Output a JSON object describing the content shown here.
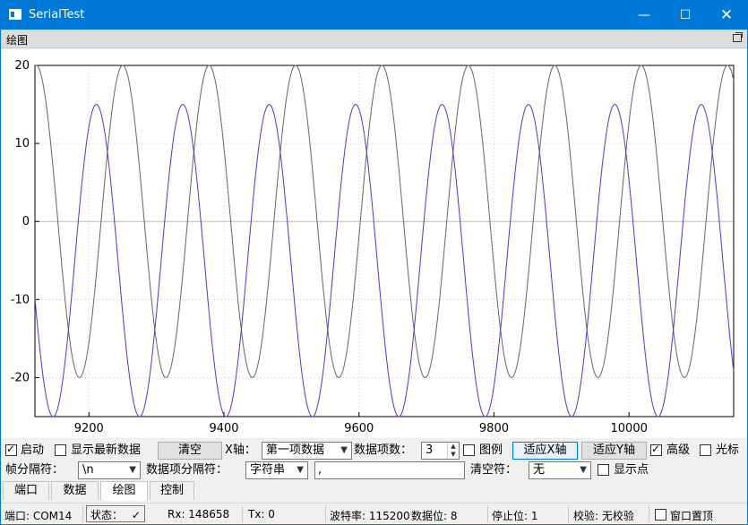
{
  "window": {
    "title": "SerialTest"
  },
  "dock": {
    "title": "绘图"
  },
  "chart_data": {
    "type": "line",
    "title": "",
    "xlabel": "",
    "ylabel": "",
    "xlim": [
      9120,
      9156
    ],
    "ylim": [
      -25,
      20
    ],
    "x_ticks": [
      "9200",
      "9400",
      "9600",
      "9800",
      "10000"
    ],
    "y_ticks": [
      "20",
      "10",
      "0",
      "-10",
      "-20"
    ],
    "grid": true,
    "legend": "none",
    "series": [
      {
        "color": "#666666",
        "amplitude": 20,
        "period": 128,
        "phase_x_peak": 9122,
        "points_sample": [
          [
            9122,
            20
          ],
          [
            9186,
            -20
          ],
          [
            9250,
            20
          ],
          [
            9314,
            -20
          ],
          [
            9378,
            20
          ]
        ]
      },
      {
        "color": "#4040c8",
        "amplitude": 20,
        "offset": -5,
        "period": 128,
        "phase_x_peak": 9211,
        "points_sample": [
          [
            9147,
            -25
          ],
          [
            9211,
            15
          ],
          [
            9275,
            -25
          ],
          [
            9339,
            15
          ],
          [
            9403,
            -25
          ]
        ]
      }
    ]
  },
  "controls": {
    "start_label": "启动",
    "show_latest_label": "显示最新数据",
    "clear_label": "清空",
    "x_axis_label": "X轴：",
    "x_axis_value": "第一项数据",
    "item_count_label": "数据项数：",
    "item_count_value": "3",
    "legend_label": "图例",
    "fit_x_label": "适应X轴",
    "fit_y_label": "适应Y轴",
    "advanced_label": "高级",
    "cursor_label": "光标",
    "frame_sep_label": "帧分隔符：",
    "frame_sep_value": "\\n",
    "item_sep_label": "数据项分隔符：",
    "item_sep_type": "字符串",
    "item_sep_value": ",",
    "blank_label": "清空符：",
    "blank_value": "无",
    "show_points_label": "显示点"
  },
  "tabs": [
    {
      "label": "端口"
    },
    {
      "label": "数据"
    },
    {
      "label": "绘图"
    },
    {
      "label": "控制"
    }
  ],
  "status": {
    "port": "端口: COM14",
    "state": "状态：",
    "state_icon": "✓",
    "rx": "Rx: 148658",
    "tx": "Tx: 0",
    "baud": "波特率: 115200",
    "data_bits": "数据位: 8",
    "stop_bits": "停止位: 1",
    "parity": "校验: 无校验",
    "ontop": "窗口置顶"
  }
}
